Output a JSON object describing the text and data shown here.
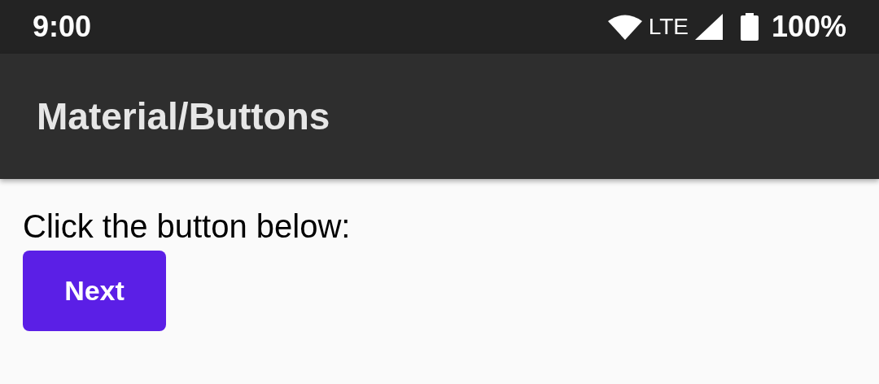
{
  "status_bar": {
    "time": "9:00",
    "network": "LTE",
    "battery": "100%"
  },
  "app_bar": {
    "title": "Material/Buttons"
  },
  "content": {
    "prompt": "Click the button below:",
    "button": "Next"
  }
}
